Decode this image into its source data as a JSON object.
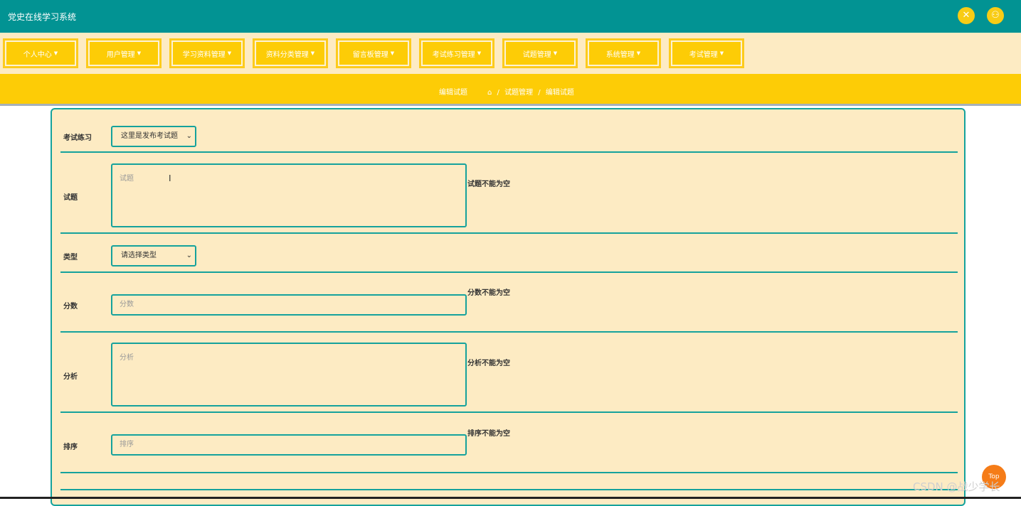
{
  "app": {
    "title": "党史在线学习系统"
  },
  "header_icons": [
    {
      "name": "fullscreen-icon",
      "glyph": "✕"
    },
    {
      "name": "user-icon",
      "glyph": "⚇"
    }
  ],
  "nav": {
    "items": [
      {
        "label": "个人中心"
      },
      {
        "label": "用户管理"
      },
      {
        "label": "学习资料管理"
      },
      {
        "label": "资料分类管理"
      },
      {
        "label": "留言板管理"
      },
      {
        "label": "考试练习管理"
      },
      {
        "label": "试题管理"
      },
      {
        "label": "系统管理"
      },
      {
        "label": "考试管理"
      }
    ],
    "caret": "▼"
  },
  "breadcrumb": {
    "title": "编辑试题",
    "home_glyph": "⌂",
    "path": [
      "试题管理",
      "编辑试题"
    ],
    "separator": "/"
  },
  "form": {
    "exam": {
      "label": "考试练习",
      "value": "这里是发布考试题"
    },
    "question": {
      "label": "试题",
      "placeholder": "试题",
      "error": "试题不能为空"
    },
    "type": {
      "label": "类型",
      "value": "请选择类型"
    },
    "score": {
      "label": "分数",
      "placeholder": "分数",
      "error": "分数不能为空"
    },
    "analysis": {
      "label": "分析",
      "placeholder": "分析",
      "error": "分析不能为空"
    },
    "order": {
      "label": "排序",
      "placeholder": "排序",
      "error": "排序不能为空"
    },
    "select_arrow": "⌄"
  },
  "top_button": {
    "label": "Top"
  },
  "watermark": "CSDN @战少学长",
  "colors": {
    "header": "#029393",
    "nav_bg": "#fdebc3",
    "accent_yellow": "#fdcc06",
    "border_teal": "#15a29c",
    "top_button": "#f57c18"
  }
}
